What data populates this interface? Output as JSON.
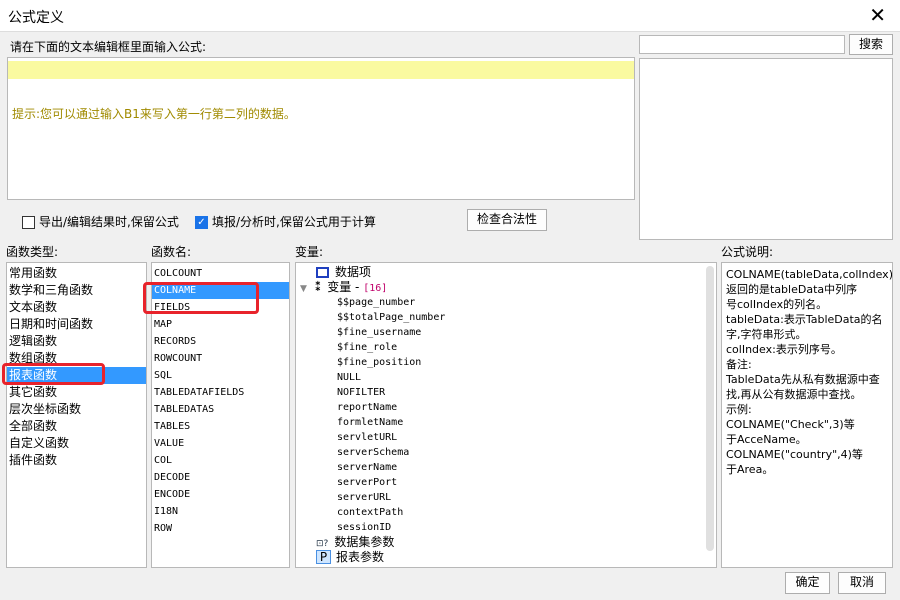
{
  "window": {
    "title": "公式定义",
    "close": "✕"
  },
  "editor": {
    "label": "请在下面的文本编辑框里面输入公式:",
    "hint": "提示:您可以通过输入B1来写入第一行第二列的数据。"
  },
  "search": {
    "placeholder": "",
    "button": "搜索"
  },
  "options": {
    "keep_export": {
      "label": "导出/编辑结果时,保留公式",
      "checked": false
    },
    "keep_fill": {
      "label": "填报/分析时,保留公式用于计算",
      "checked": true
    },
    "check_button": "检查合法性"
  },
  "function_types": {
    "label": "函数类型:",
    "items": [
      "常用函数",
      "数学和三角函数",
      "文本函数",
      "日期和时间函数",
      "逻辑函数",
      "数组函数",
      "报表函数",
      "其它函数",
      "层次坐标函数",
      "全部函数",
      "自定义函数",
      "插件函数"
    ],
    "selected": "报表函数"
  },
  "function_names": {
    "label": "函数名:",
    "items": [
      "COLCOUNT",
      "COLNAME",
      "FIELDS",
      "MAP",
      "RECORDS",
      "ROWCOUNT",
      "SQL",
      "TABLEDATAFIELDS",
      "TABLEDATAS",
      "TABLES",
      "VALUE",
      "COL",
      "DECODE",
      "ENCODE",
      "I18N",
      "ROW"
    ],
    "selected": "COLNAME"
  },
  "variables": {
    "label": "变量:",
    "data_items": "数据项",
    "var_group": "变量",
    "var_sep": " - ",
    "var_count": "[16]",
    "vars": [
      "$$page_number",
      "$$totalPage_number",
      "$fine_username",
      "$fine_role",
      "$fine_position",
      "NULL",
      "NOFILTER",
      "reportName",
      "formletName",
      "servletURL",
      "serverSchema",
      "serverName",
      "serverPort",
      "serverURL",
      "contextPath",
      "sessionID"
    ],
    "dataset_params": "数据集参数",
    "report_params": "报表参数"
  },
  "description": {
    "label": "公式说明:",
    "lines": [
      "COLNAME(tableData,colIndex)",
      "返回的是tableData中列序",
      "号colIndex的列名。",
      "tableData:表示TableData的名",
      "字,字符串形式。",
      "colIndex:表示列序号。",
      "备注:",
      "TableData先从私有数据源中查",
      "找,再从公有数据源中查找。",
      "示例:",
      "COLNAME(\"Check\",3)等",
      "于AcceName。",
      "COLNAME(\"country\",4)等",
      "于Area。"
    ]
  },
  "footer": {
    "ok": "确定",
    "cancel": "取消"
  },
  "colors": {
    "selection": "#3399ff",
    "highlight": "#e8232b",
    "hint": "#a08a00",
    "editor_line": "#fafaa0"
  }
}
